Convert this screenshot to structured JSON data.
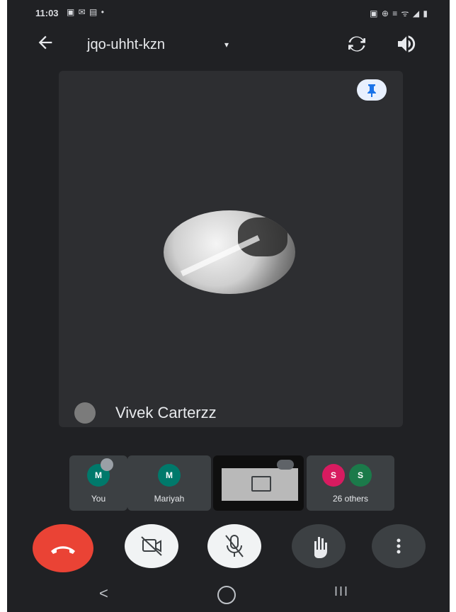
{
  "status_bar": {
    "time": "11:03",
    "notification_icons": [
      "image-icon",
      "mail-icon",
      "message-icon",
      "dot-icon"
    ],
    "system_icons": [
      "nfc-icon",
      "vpn-icon",
      "data-icon",
      "wifi-icon",
      "signal-icon",
      "battery-icon"
    ],
    "notif_text": "▣ ✉ ▤ •",
    "sys_text": "▣ ⊕ ≡ ᯤ ◢ ▮"
  },
  "header": {
    "back_icon": "arrow-back-icon",
    "meeting_code": "jqo-uhht-kzn",
    "dropdown_icon": "▾",
    "switch_camera_icon": "switch-camera-icon",
    "audio_icon": "volume-icon"
  },
  "main_tile": {
    "participant_name": "Vivek Carterzz",
    "pin_icon": "pin-icon"
  },
  "participant_strip": [
    {
      "label": "You",
      "initial": "M"
    },
    {
      "label": "Mariyah",
      "initial": "M"
    },
    {
      "label": "",
      "type": "presentation"
    },
    {
      "label": "26 others",
      "initials": [
        "S",
        "S"
      ]
    }
  ],
  "controls": {
    "end_call": "call-end-icon",
    "camera": "camera-off-icon",
    "microphone": "mic-off-icon",
    "raise_hand": "hand-icon",
    "more": "more-vert-icon"
  },
  "nav_bar": {
    "back_symbol": "<",
    "recents_symbol": "III"
  },
  "colors": {
    "background": "#202124",
    "tile": "#2d2e31",
    "end_call": "#ea4335",
    "avatar_teal": "#00796b",
    "avatar_pink": "#d81b60",
    "avatar_green": "#1b7a4a"
  }
}
